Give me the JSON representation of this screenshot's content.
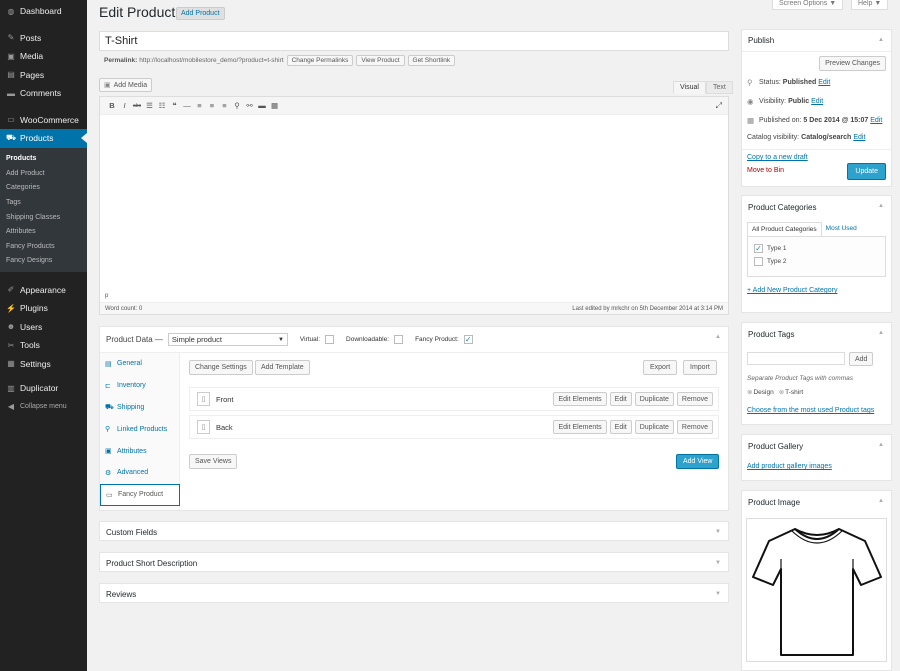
{
  "sidebar": {
    "items": [
      {
        "label": "Dashboard",
        "icon": "dashboard-icon",
        "glyph": "◍"
      },
      {
        "label": "Posts",
        "icon": "pin-icon",
        "glyph": "✎"
      },
      {
        "label": "Media",
        "icon": "media-icon",
        "glyph": "▣"
      },
      {
        "label": "Pages",
        "icon": "pages-icon",
        "glyph": "▤"
      },
      {
        "label": "Comments",
        "icon": "comments-icon",
        "glyph": "▬"
      },
      {
        "label": "WooCommerce",
        "icon": "woocommerce-icon",
        "glyph": "▭"
      },
      {
        "label": "Products",
        "icon": "cart-icon",
        "glyph": "⛟"
      },
      {
        "label": "Appearance",
        "icon": "brush-icon",
        "glyph": "✐"
      },
      {
        "label": "Plugins",
        "icon": "plugin-icon",
        "glyph": "⚡"
      },
      {
        "label": "Users",
        "icon": "users-icon",
        "glyph": "☻"
      },
      {
        "label": "Tools",
        "icon": "wrench-icon",
        "glyph": "✂"
      },
      {
        "label": "Settings",
        "icon": "settings-icon",
        "glyph": "▦"
      },
      {
        "label": "Duplicator",
        "icon": "duplicator-icon",
        "glyph": "▥"
      },
      {
        "label": "Collapse menu",
        "icon": "collapse-icon",
        "glyph": "◀"
      }
    ],
    "submenu": [
      "Products",
      "Add Product",
      "Categories",
      "Tags",
      "Shipping Classes",
      "Attributes",
      "Fancy Products",
      "Fancy Designs"
    ]
  },
  "header": {
    "title": "Edit Product",
    "add_button": "Add Product",
    "screen_options": "Screen Options ▼",
    "help": "Help ▼"
  },
  "post": {
    "title": "T-Shirt",
    "permalink_label": "Permalink:",
    "permalink_url": "http://localhost/mobilestore_demo/?product=t-shirt",
    "change_permalinks": "Change Permalinks",
    "view_product": "View Product",
    "get_shortlink": "Get Shortlink"
  },
  "editor": {
    "add_media": "Add Media",
    "tab_visual": "Visual",
    "tab_text": "Text",
    "toolbar": [
      {
        "glyph": "B",
        "name": "bold-icon"
      },
      {
        "glyph": "I",
        "name": "italic-icon"
      },
      {
        "glyph": "abc",
        "name": "strikethrough-icon"
      },
      {
        "glyph": "☰",
        "name": "bullet-list-icon"
      },
      {
        "glyph": "☷",
        "name": "numbered-list-icon"
      },
      {
        "glyph": "❝",
        "name": "blockquote-icon"
      },
      {
        "glyph": "—",
        "name": "horizontal-rule-icon"
      },
      {
        "glyph": "≡",
        "name": "align-left-icon"
      },
      {
        "glyph": "≡",
        "name": "align-center-icon"
      },
      {
        "glyph": "≡",
        "name": "align-right-icon"
      },
      {
        "glyph": "⚲",
        "name": "link-icon"
      },
      {
        "glyph": "⚯",
        "name": "unlink-icon"
      },
      {
        "glyph": "▬",
        "name": "read-more-icon"
      },
      {
        "glyph": "▦",
        "name": "toolbar-toggle-icon"
      }
    ],
    "path": "p",
    "word_count": "Word count: 0",
    "last_edited": "Last edited by mrkchr on 5th December 2014 at 3:14 PM"
  },
  "product_data": {
    "label": "Product Data —",
    "type_selected": "Simple product",
    "virtual_label": "Virtual:",
    "downloadable_label": "Downloadable:",
    "fancy_product_label": "Fancy Product:",
    "tabs": [
      {
        "label": "General",
        "icon": "general-icon",
        "glyph": "▤"
      },
      {
        "label": "Inventory",
        "icon": "inventory-icon",
        "glyph": "⊏"
      },
      {
        "label": "Shipping",
        "icon": "shipping-icon",
        "glyph": "⛟"
      },
      {
        "label": "Linked Products",
        "icon": "linked-products-icon",
        "glyph": "⚲"
      },
      {
        "label": "Attributes",
        "icon": "attributes-icon",
        "glyph": "▣"
      },
      {
        "label": "Advanced",
        "icon": "advanced-icon",
        "glyph": "⚙"
      },
      {
        "label": "Fancy Product",
        "icon": "fancy-product-icon",
        "glyph": "▭"
      }
    ],
    "change_settings": "Change Settings",
    "add_template": "Add Template",
    "export": "Export",
    "import": "Import",
    "views": [
      {
        "name": "Front"
      },
      {
        "name": "Back"
      }
    ],
    "edit_elements": "Edit Elements",
    "edit": "Edit",
    "duplicate": "Duplicate",
    "remove": "Remove",
    "save_views": "Save Views",
    "add_view": "Add View"
  },
  "lower_boxes": [
    "Custom Fields",
    "Product Short Description",
    "Reviews"
  ],
  "publish": {
    "title": "Publish",
    "preview": "Preview Changes",
    "status_label": "Status:",
    "status": "Published",
    "visibility_label": "Visibility:",
    "visibility": "Public",
    "published_label": "Published on:",
    "published": "5 Dec 2014 @ 15:07",
    "catalog_label": "Catalog visibility:",
    "catalog": "Catalog/search",
    "edit": "Edit",
    "copy_draft": "Copy to a new draft",
    "move_bin": "Move to Bin",
    "update": "Update"
  },
  "categories": {
    "title": "Product Categories",
    "tab_all": "All Product Categories",
    "tab_used": "Most Used",
    "items": [
      {
        "label": "Type 1",
        "checked": "✓"
      },
      {
        "label": "Type 2",
        "checked": ""
      }
    ],
    "add_new": "+ Add New Product Category"
  },
  "tags": {
    "title": "Product Tags",
    "add": "Add",
    "hint": "Separate Product Tags with commas",
    "tag1": "Design",
    "tag2": "T-shirt",
    "choose": "Choose from the most used Product tags"
  },
  "gallery": {
    "title": "Product Gallery",
    "add": "Add product gallery images"
  },
  "product_image": {
    "title": "Product Image"
  },
  "colors": {
    "sidebar": "#222222",
    "accent": "#0073aa",
    "update_button": "#2ea2cc",
    "move_bin": "#a00000"
  }
}
